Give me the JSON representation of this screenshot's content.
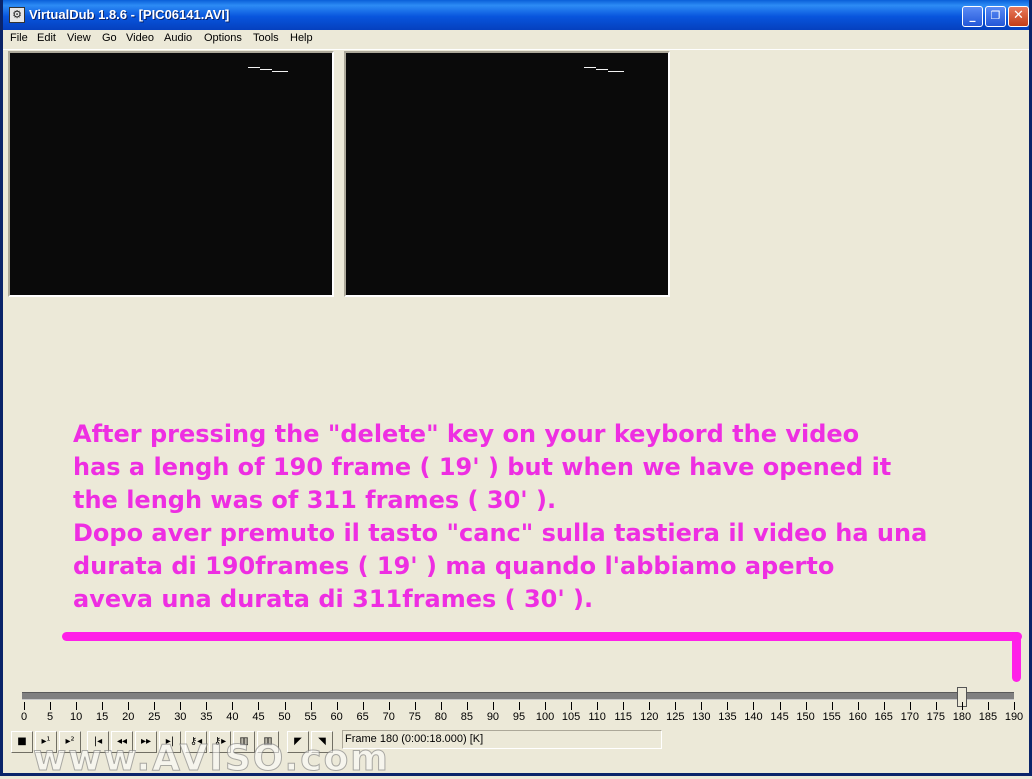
{
  "window": {
    "title": "VirtualDub 1.8.6 - [PIC06141.AVI]",
    "controls": {
      "minimize": "_",
      "maximize": "❐",
      "close": "✕"
    }
  },
  "menubar": {
    "items": [
      "File",
      "Edit",
      "View",
      "Go",
      "Video",
      "Audio",
      "Options",
      "Tools",
      "Help"
    ]
  },
  "overlay": {
    "lines": [
      "After pressing the \"delete\" key on your keybord the video",
      "has a lengh of 190 frame ( 19' ) but when we have opened it",
      "the lengh was of 311 frames ( 30' ).",
      "Dopo aver premuto il tasto \"canc\" sulla tastiera il video ha una",
      "durata di 190frames ( 19' ) ma quando l'abbiamo aperto",
      "aveva una durata di 311frames ( 30' )."
    ],
    "color": "#EE2EE2",
    "bracket_color": "#FF1FE8"
  },
  "timeline": {
    "min": 0,
    "max": 190,
    "current_frame": 180,
    "tick_labels": [
      "0",
      "5",
      "10",
      "15",
      "20",
      "25",
      "30",
      "35",
      "40",
      "45",
      "50",
      "55",
      "60",
      "65",
      "70",
      "75",
      "80",
      "85",
      "90",
      "95",
      "100",
      "105",
      "110",
      "115",
      "120",
      "125",
      "130",
      "135",
      "140",
      "145",
      "150",
      "155",
      "160",
      "165",
      "170",
      "175",
      "180",
      "185",
      "190"
    ]
  },
  "toolbar": {
    "buttons": [
      {
        "name": "stop-button",
        "icon": "stop-icon",
        "glyph": "■"
      },
      {
        "name": "play-input-button",
        "icon": "play-input-icon",
        "glyph": "▸¹"
      },
      {
        "name": "play-output-button",
        "icon": "play-output-icon",
        "glyph": "▸²"
      },
      {
        "name": "go-to-start-button",
        "icon": "go-to-start-icon",
        "glyph": "|◂"
      },
      {
        "name": "previous-key-button",
        "icon": "rewind-icon",
        "glyph": "◂◂"
      },
      {
        "name": "next-key-button",
        "icon": "fast-forward-icon",
        "glyph": "▸▸"
      },
      {
        "name": "go-to-end-button",
        "icon": "go-to-end-icon",
        "glyph": "▸|"
      },
      {
        "name": "previous-keyframe-button",
        "icon": "key-previous-icon",
        "glyph": "⚷◂"
      },
      {
        "name": "next-keyframe-button",
        "icon": "key-next-icon",
        "glyph": "⚷▸"
      },
      {
        "name": "previous-scene-button",
        "icon": "scene-previous-icon",
        "glyph": "▥"
      },
      {
        "name": "next-scene-button",
        "icon": "scene-next-icon",
        "glyph": "▥"
      },
      {
        "name": "mark-in-button",
        "icon": "mark-in-icon",
        "glyph": "◤"
      },
      {
        "name": "mark-out-button",
        "icon": "mark-out-icon",
        "glyph": "◥"
      }
    ],
    "status_text": "Frame 180 (0:00:18.000) [K]"
  },
  "watermark": "www.AVISO.com"
}
